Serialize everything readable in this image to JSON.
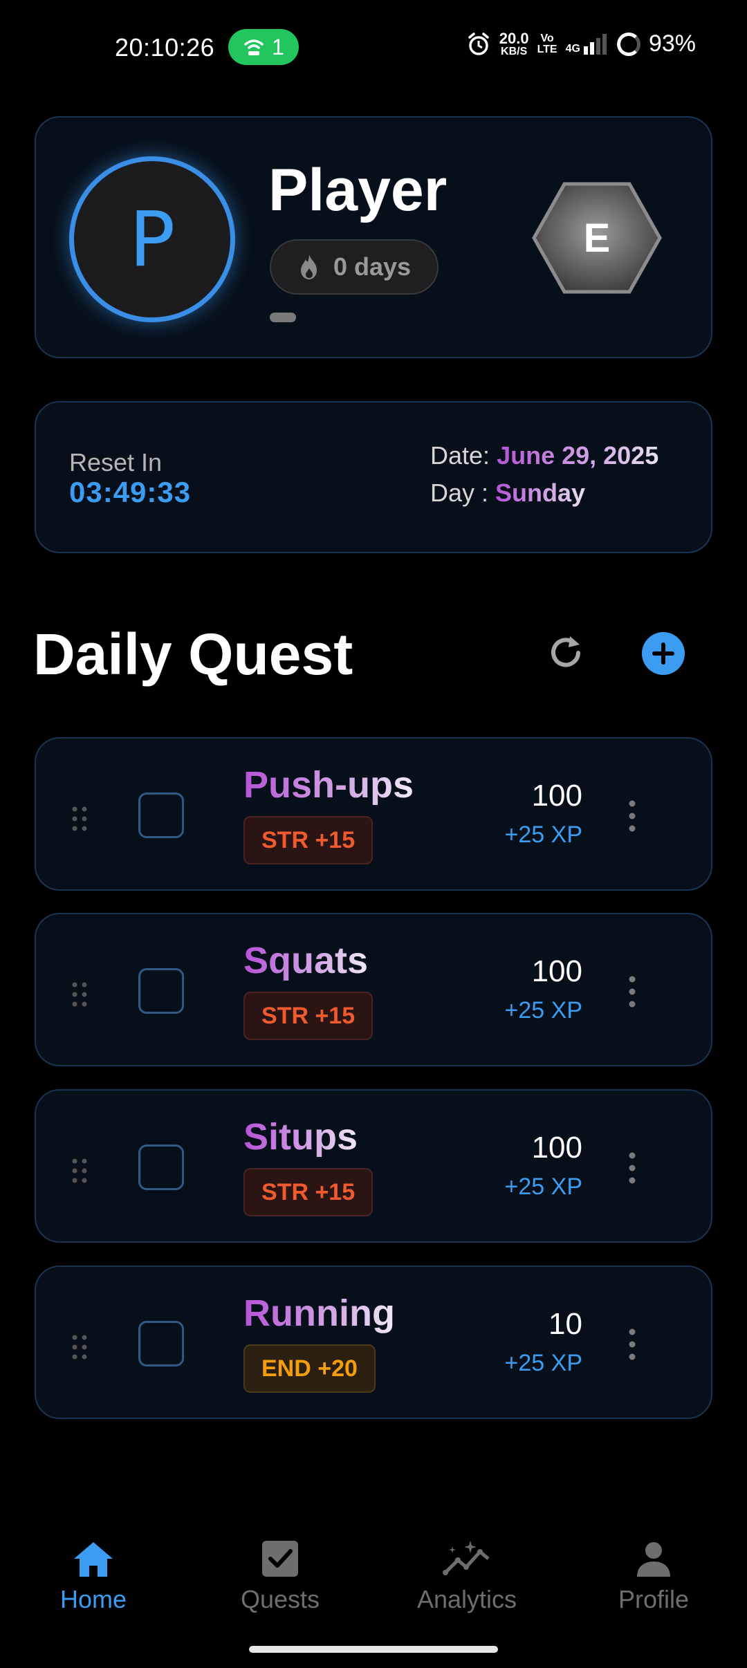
{
  "status_bar": {
    "time": "20:10:26",
    "hotspot_count": "1",
    "net_speed_value": "20.0",
    "net_speed_unit": "KB/S",
    "volte_top": "Vo",
    "volte_bottom": "LTE",
    "network_type": "4G",
    "battery": "93%"
  },
  "player": {
    "avatar_letter": "P",
    "name": "Player",
    "streak": "0 days",
    "rank": "E"
  },
  "info": {
    "reset_label": "Reset In",
    "reset_time": "03:49:33",
    "date_label": "Date:",
    "date_value": "June 29, 2025",
    "day_label": "Day  :",
    "day_value": "Sunday"
  },
  "section": {
    "title": "Daily Quest"
  },
  "quests": [
    {
      "name": "Push-ups",
      "tag": "STR +15",
      "target": "100",
      "xp": "+25 XP"
    },
    {
      "name": "Squats",
      "tag": "STR +15",
      "target": "100",
      "xp": "+25 XP"
    },
    {
      "name": "Situps",
      "tag": "STR +15",
      "target": "100",
      "xp": "+25 XP"
    },
    {
      "name": "Running",
      "tag": "END +20",
      "target": "10",
      "xp": "+25 XP"
    }
  ],
  "nav": {
    "home": "Home",
    "quests": "Quests",
    "analytics": "Analytics",
    "profile": "Profile",
    "active": "Home"
  },
  "colors": {
    "accent": "#3b9cf2",
    "purple": "#b552d6",
    "str": "#ef5a2e",
    "end": "#f59e0b",
    "streak_bar": "#22c55e"
  }
}
